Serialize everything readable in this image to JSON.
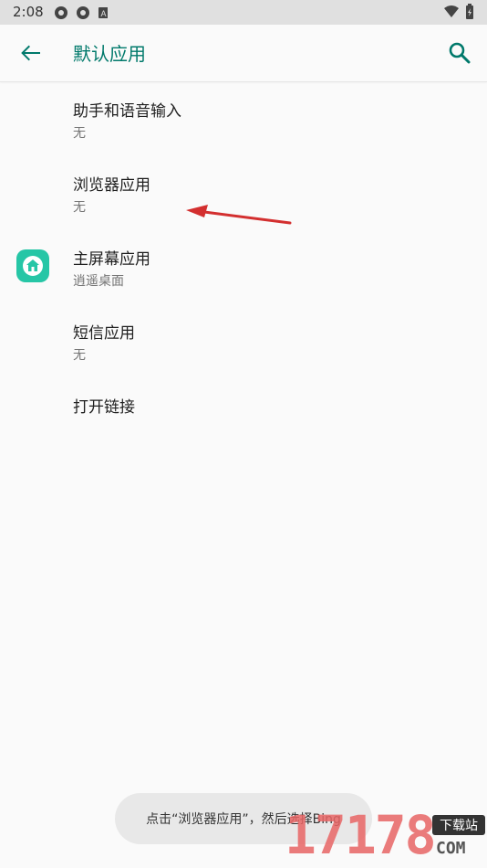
{
  "status": {
    "time": "2:08"
  },
  "appbar": {
    "title": "默认应用",
    "back_icon": "arrow-back-icon",
    "search_icon": "search-icon"
  },
  "items": [
    {
      "title": "助手和语音输入",
      "subtitle": "无"
    },
    {
      "title": "浏览器应用",
      "subtitle": "无"
    },
    {
      "title": "主屏幕应用",
      "subtitle": "逍遥桌面",
      "icon": "home-icon",
      "icon_color": "#26c6a6"
    },
    {
      "title": "短信应用",
      "subtitle": "无"
    },
    {
      "title": "打开链接"
    }
  ],
  "toast": {
    "text": "点击“浏览器应用”，然后选择Bing"
  },
  "watermark": {
    "digits": "17178",
    "badge": "下载站",
    "domain": "COM"
  },
  "colors": {
    "accent": "#00796b",
    "annotation_arrow": "#d32f2f"
  }
}
